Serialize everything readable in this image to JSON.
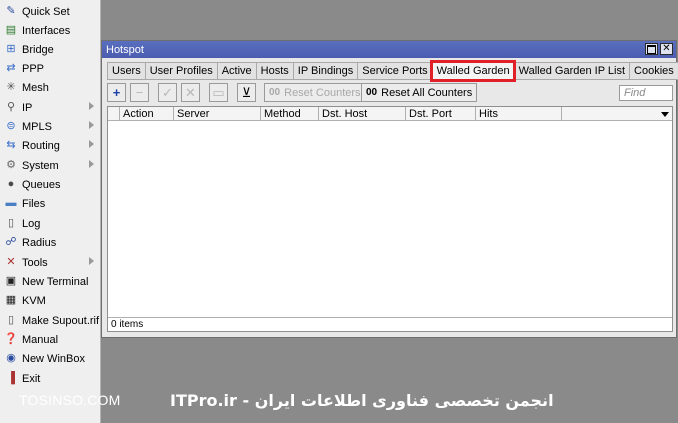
{
  "sidebar": {
    "items": [
      {
        "label": "Quick Set",
        "icon": "quick-set-icon",
        "submenu": false
      },
      {
        "label": "Interfaces",
        "icon": "interfaces-icon",
        "submenu": false
      },
      {
        "label": "Bridge",
        "icon": "bridge-icon",
        "submenu": false
      },
      {
        "label": "PPP",
        "icon": "ppp-icon",
        "submenu": false
      },
      {
        "label": "Mesh",
        "icon": "mesh-icon",
        "submenu": false
      },
      {
        "label": "IP",
        "icon": "ip-icon",
        "submenu": true
      },
      {
        "label": "MPLS",
        "icon": "mpls-icon",
        "submenu": true
      },
      {
        "label": "Routing",
        "icon": "routing-icon",
        "submenu": true
      },
      {
        "label": "System",
        "icon": "system-icon",
        "submenu": true
      },
      {
        "label": "Queues",
        "icon": "queues-icon",
        "submenu": false
      },
      {
        "label": "Files",
        "icon": "files-icon",
        "submenu": false
      },
      {
        "label": "Log",
        "icon": "log-icon",
        "submenu": false
      },
      {
        "label": "Radius",
        "icon": "radius-icon",
        "submenu": false
      },
      {
        "label": "Tools",
        "icon": "tools-icon",
        "submenu": true
      },
      {
        "label": "New Terminal",
        "icon": "terminal-icon",
        "submenu": false
      },
      {
        "label": "KVM",
        "icon": "kvm-icon",
        "submenu": false
      },
      {
        "label": "Make Supout.rif",
        "icon": "supout-icon",
        "submenu": false
      },
      {
        "label": "Manual",
        "icon": "manual-icon",
        "submenu": false
      },
      {
        "label": "New WinBox",
        "icon": "winbox-icon",
        "submenu": false
      },
      {
        "label": "Exit",
        "icon": "exit-icon",
        "submenu": false
      }
    ]
  },
  "window": {
    "title": "Hotspot",
    "tabs": [
      {
        "label": "Users",
        "active": false
      },
      {
        "label": "User Profiles",
        "active": false
      },
      {
        "label": "Active",
        "active": false
      },
      {
        "label": "Hosts",
        "active": false
      },
      {
        "label": "IP Bindings",
        "active": false
      },
      {
        "label": "Service Ports",
        "active": false
      },
      {
        "label": "Walled Garden",
        "active": true
      },
      {
        "label": "Walled Garden IP List",
        "active": false
      },
      {
        "label": "Cookies",
        "active": false
      },
      {
        "label": "...",
        "active": false
      }
    ],
    "toolbar": {
      "add_label": "+",
      "remove_label": "−",
      "enable_label": "✓",
      "disable_label": "✕",
      "comment_label": "▭",
      "filter_label": "⊻",
      "counter_prefix": "00",
      "reset_counters_label": "Reset Counters",
      "reset_all_counters_label": "Reset All Counters",
      "find_placeholder": "Find"
    },
    "table": {
      "columns": [
        "Action",
        "Server",
        "Method",
        "Dst. Host",
        "Dst. Port",
        "Hits"
      ],
      "rows": [],
      "status": "0 items"
    }
  },
  "banner": {
    "left_text": "TOSINSO.COM",
    "right_text": "ITPro.ir - انجمن تخصصی فناوری اطلاعات ایران"
  },
  "colors": {
    "titlebar": "#5266b8",
    "highlight": "#e01f27",
    "desktop": "#8a8a8a",
    "sidebar": "#efefef"
  }
}
